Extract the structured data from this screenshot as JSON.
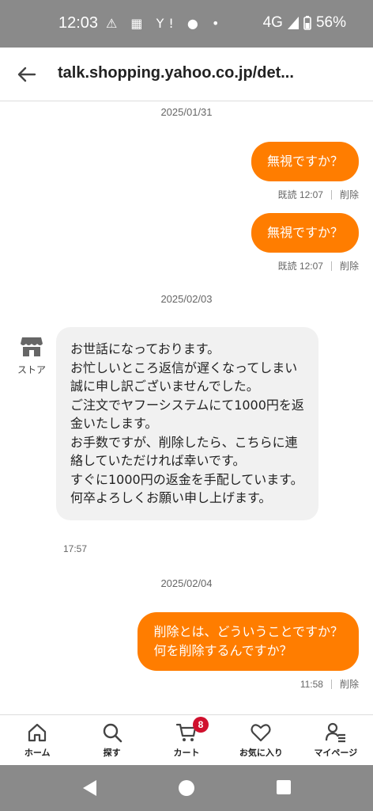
{
  "status_bar": {
    "time": "12:03",
    "left_icons": "⚠ ▦ Y! ● •",
    "network": "4G",
    "battery": "56%"
  },
  "app_bar": {
    "back_icon": "arrow-left-icon",
    "url": "talk.shopping.yahoo.co.jp/det..."
  },
  "chat": {
    "dates": [
      "2025/01/31",
      "2025/02/03",
      "2025/02/04"
    ],
    "messages": [
      {
        "direction": "out",
        "text": "無視ですか？",
        "status": "既読",
        "time": "12:07",
        "action": "削除"
      },
      {
        "direction": "out",
        "text": "無視ですか？",
        "status": "既読",
        "time": "12:07",
        "action": "削除"
      },
      {
        "direction": "in",
        "sender": "ストア",
        "text": "お世話になっております。\nお忙しいところ返信が遅くなってしまい誠に申し訳ございませんでした。\nご注文でヤフーシステムにて1000円を返金いたします。\nお手数ですが、削除したら、こちらに連絡していただければ幸いです。\nすぐに1000円の返金を手配しています。\n何卒よろしくお願い申し上げます。",
        "time": "17:57"
      },
      {
        "direction": "out",
        "text": "削除とは、どういうことですか？\n何を削除するんですか？",
        "status": "",
        "time": "11:58",
        "action": "削除"
      }
    ]
  },
  "bottom_nav": {
    "items": [
      {
        "label": "ホーム",
        "icon": "home-icon"
      },
      {
        "label": "探す",
        "icon": "search-icon"
      },
      {
        "label": "カート",
        "icon": "cart-icon",
        "badge": "8"
      },
      {
        "label": "お気に入り",
        "icon": "heart-icon"
      },
      {
        "label": "マイページ",
        "icon": "user-icon"
      }
    ]
  },
  "colors": {
    "accent": "#ff7d00",
    "badge": "#d0102d",
    "status_bar": "#8a8a8a"
  }
}
